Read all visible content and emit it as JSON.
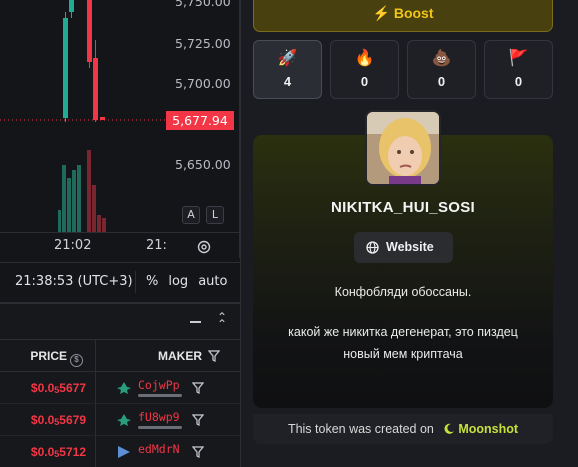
{
  "chart": {
    "price_labels": [
      "5,750.00",
      "5,725.00",
      "5,700.00",
      "5,650.00"
    ],
    "current_price": "5,677.94",
    "time_ticks": [
      "21:02",
      "21:"
    ],
    "scale_buttons": [
      "A",
      "L"
    ],
    "clock": "21:38:53 (UTC+3)",
    "options": [
      "%",
      "log",
      "auto"
    ]
  },
  "trades": {
    "price_header": "PRICE",
    "maker_header": "MAKER",
    "rows": [
      {
        "price_prefix": "$0.0",
        "price_sub": "5",
        "price_rest": "5677",
        "maker": "CojwPp"
      },
      {
        "price_prefix": "$0.0",
        "price_sub": "5",
        "price_rest": "5679",
        "maker": "fU8wp9"
      },
      {
        "price_prefix": "$0.0",
        "price_sub": "5",
        "price_rest": "5712",
        "maker": "edMdrN"
      }
    ]
  },
  "panel": {
    "boost_label": "Boost",
    "reactions": [
      {
        "icon": "rocket-icon",
        "emoji": "🚀",
        "count": "4"
      },
      {
        "icon": "fire-icon",
        "emoji": "🔥",
        "count": "0"
      },
      {
        "icon": "poop-icon",
        "emoji": "💩",
        "count": "0"
      },
      {
        "icon": "flag-icon",
        "emoji": "🚩",
        "count": "0"
      }
    ],
    "token_name": "NIKITKA_HUI_SOSI",
    "website_label": "Website",
    "description_1": "Конфобляди обоссаны.",
    "description_2": "какой же никитка дегенерат, это пиздец",
    "description_3": "новый мем криптача",
    "footer_text": "This token was created on",
    "footer_brand": "Moonshot"
  },
  "colors": {
    "up": "#22ab94",
    "down": "#f23645",
    "boost": "#f0c419",
    "moonshot": "#c8e03a"
  }
}
